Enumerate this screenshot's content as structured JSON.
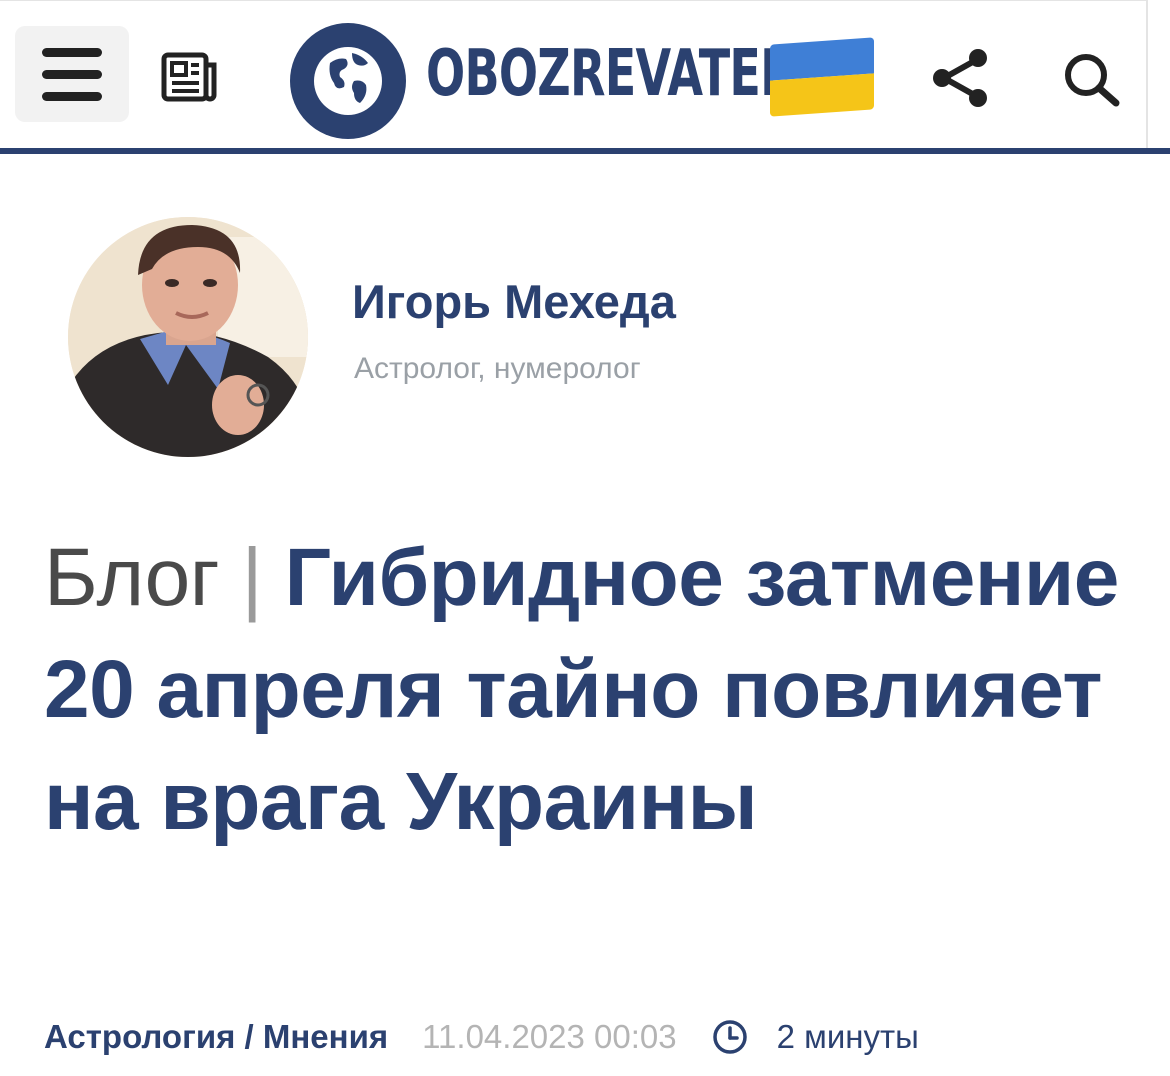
{
  "header": {
    "logo_text": "OBOZREVATEL",
    "menu_icon": "hamburger-icon",
    "news_icon": "newspaper-icon",
    "share_icon": "share-icon",
    "search_icon": "search-icon",
    "globe_icon": "globe-icon",
    "flag_icon": "ukraine-flag-icon"
  },
  "colors": {
    "brand": "#2b4170",
    "flag_blue": "#3f7fd6",
    "flag_yellow": "#f5c518",
    "muted": "#9aa0a6"
  },
  "author": {
    "name": "Игорь Мехеда",
    "role": "Астролог, нумеролог"
  },
  "article": {
    "prefix": "Блог",
    "separator": "|",
    "headline": "Гибридное затмение 20 апреля тайно повлияет на врага Украины",
    "categories": "Астрология / Мнения",
    "date": "11.04.2023 00:03",
    "read_time": "2 минуты",
    "clock_icon": "clock-icon"
  }
}
